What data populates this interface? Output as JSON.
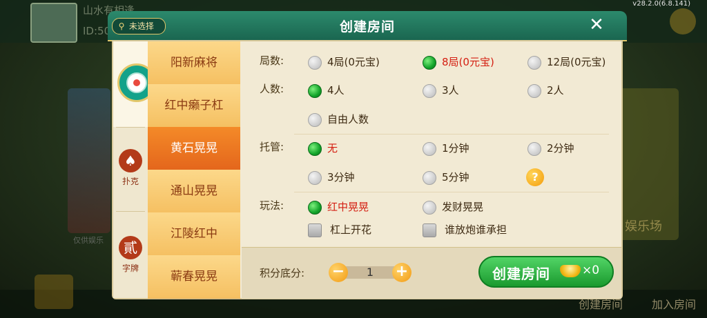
{
  "background": {
    "version": "v28.2.0(6.8.141)",
    "username": "山水有相逢",
    "user_id": "ID:50",
    "left_caption": "仅供娱乐",
    "right_caption": "娱乐场",
    "bottom_create": "创建房间",
    "bottom_join": "加入房间"
  },
  "dialog": {
    "title": "创建房间",
    "location_label": "未选择",
    "close_label": "✕"
  },
  "categories": [
    {
      "id": "mahjong",
      "label": ""
    },
    {
      "id": "poker",
      "label": "扑克",
      "icon": "♠"
    },
    {
      "id": "zipai",
      "label": "字牌",
      "icon": "貳"
    }
  ],
  "games": [
    "阳新麻将",
    "红中癞子杠",
    "黄石晃晃",
    "通山晃晃",
    "江陵红中",
    "蕲春晃晃"
  ],
  "active_game": "黄石晃晃",
  "options": {
    "rounds": {
      "label": "局数:",
      "choices": [
        "4局(0元宝)",
        "8局(0元宝)",
        "12局(0元宝)"
      ],
      "selected": "8局(0元宝)"
    },
    "players": {
      "label": "人数:",
      "choices": [
        "4人",
        "3人",
        "2人",
        "自由人数"
      ],
      "selected": "4人"
    },
    "trustee": {
      "label": "托管:",
      "choices": [
        "无",
        "1分钟",
        "2分钟",
        "3分钟",
        "5分钟"
      ],
      "selected": "无",
      "help": "?"
    },
    "play": {
      "label": "玩法:",
      "choices": [
        "红中晃晃",
        "发财晃晃"
      ],
      "selected": "红中晃晃",
      "checkboxes": [
        "杠上开花",
        "谁放炮谁承担"
      ]
    }
  },
  "footer": {
    "score_label": "积分底分:",
    "score_value": "1",
    "minus": "−",
    "plus": "+",
    "create_label": "创建房间",
    "cost": "×0"
  },
  "colors": {
    "accent_green": "#1a9a2e",
    "selected_text": "#d41d10",
    "active_tab": "#e4661c"
  }
}
